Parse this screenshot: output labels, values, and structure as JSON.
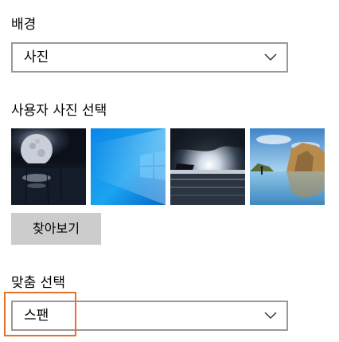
{
  "background": {
    "label": "배경",
    "selected_value": "사진"
  },
  "picture_picker": {
    "label": "사용자 사진 선택",
    "thumbnails": [
      {
        "name": "moon-lake"
      },
      {
        "name": "windows-blue"
      },
      {
        "name": "sunburst-sea"
      },
      {
        "name": "beach-rocks"
      }
    ],
    "browse_label": "찾아보기"
  },
  "fit": {
    "label": "맞춤 선택",
    "selected_value": "스팬"
  },
  "colors": {
    "dropdown_border": "#999999",
    "button_bg": "#cccccc",
    "highlight": "#e8702a"
  }
}
